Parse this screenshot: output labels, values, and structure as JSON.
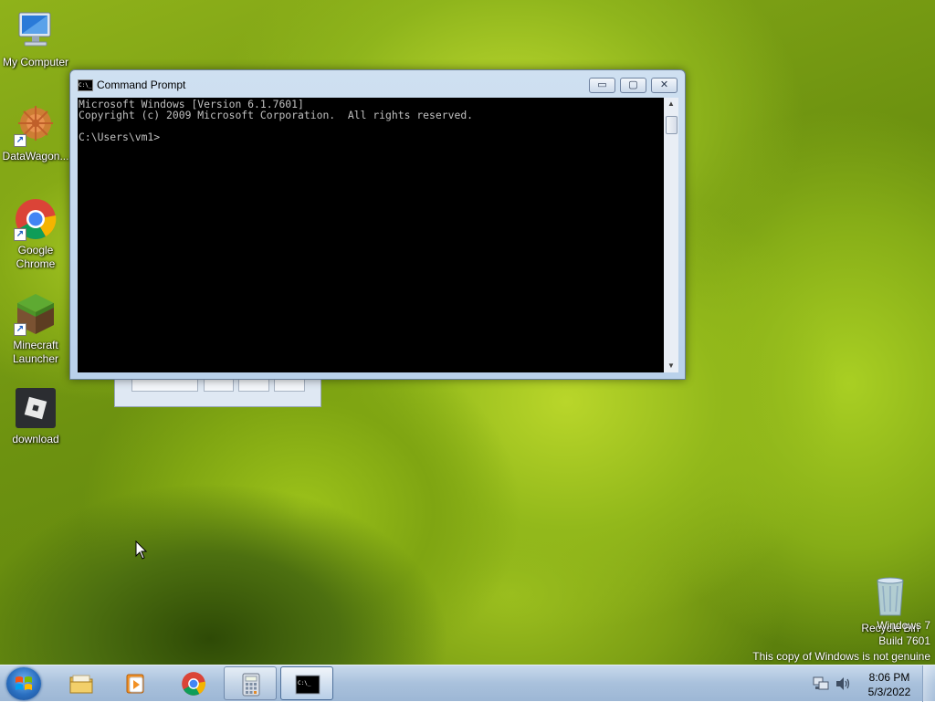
{
  "desktop": {
    "icons": [
      {
        "label": "My Computer",
        "icon": "computer-icon"
      },
      {
        "label": "DataWagon...",
        "icon": "datawagon-icon"
      },
      {
        "label": "Google Chrome",
        "icon": "chrome-icon"
      },
      {
        "label": "Minecraft Launcher",
        "icon": "minecraft-icon"
      },
      {
        "label": "download",
        "icon": "roblox-icon"
      },
      {
        "label": "Recycle Bin",
        "icon": "recycle-bin-icon"
      }
    ],
    "watermark": {
      "line1": "Windows 7",
      "line2": "Build 7601",
      "line3": "This copy of Windows is not genuine"
    }
  },
  "cmd_window": {
    "title": "Command Prompt",
    "icon_text": "C:\\_",
    "lines": [
      "Microsoft Windows [Version 6.1.7601]",
      "Copyright (c) 2009 Microsoft Corporation.  All rights reserved.",
      "",
      "C:\\Users\\vm1>"
    ],
    "minimize_symbol": "▭",
    "maximize_symbol": "▢",
    "close_symbol": "✕"
  },
  "taskbar": {
    "items": [
      {
        "name": "windows-explorer",
        "icon": "folder-icon",
        "state": "pinned"
      },
      {
        "name": "media-player",
        "icon": "media-player-icon",
        "state": "pinned"
      },
      {
        "name": "chrome",
        "icon": "chrome-icon",
        "state": "pinned"
      },
      {
        "name": "calculator",
        "icon": "calculator-icon",
        "state": "open"
      },
      {
        "name": "command-prompt",
        "icon": "cmd-icon",
        "state": "active"
      }
    ],
    "clock": {
      "time": "8:06 PM",
      "date": "5/3/2022"
    }
  }
}
